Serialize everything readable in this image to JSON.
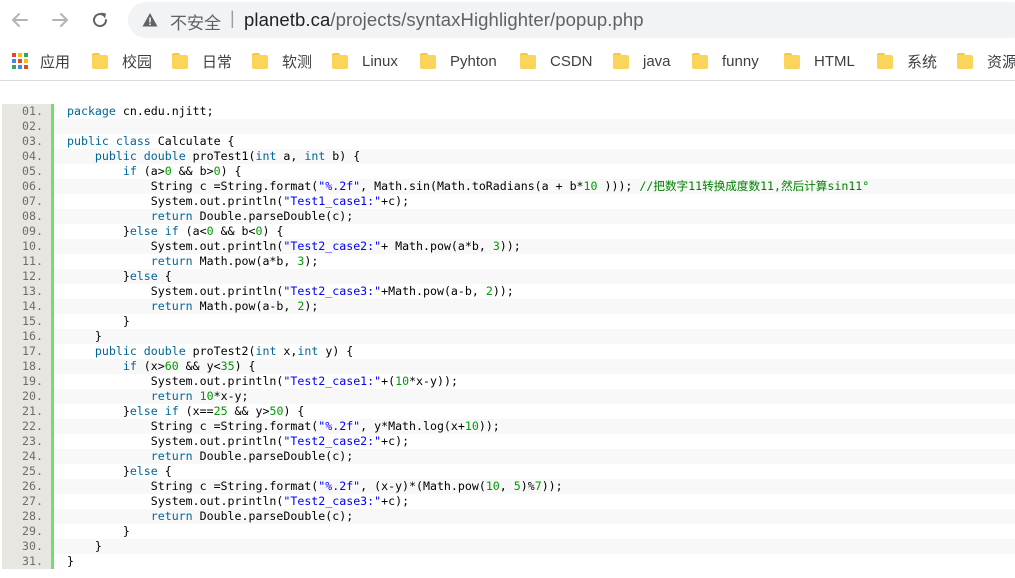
{
  "browser": {
    "security_label": "不安全",
    "separator": "|",
    "url_domain": "planetb.ca",
    "url_path": "/projects/syntaxHighlighter/popup.php"
  },
  "bookmarks": {
    "apps_label": "应用",
    "items": [
      "校园",
      "日常",
      "软测",
      "Linux",
      "Pyhton",
      "CSDN",
      "java",
      "funny",
      "HTML",
      "系统",
      "资源"
    ]
  },
  "code": {
    "lines": [
      {
        "n": "01.",
        "t": [
          [
            "kw",
            "package"
          ],
          [
            "plain",
            " cn.edu.njitt;"
          ]
        ]
      },
      {
        "n": "02.",
        "t": []
      },
      {
        "n": "03.",
        "t": [
          [
            "kw",
            "public"
          ],
          [
            "plain",
            " "
          ],
          [
            "kw",
            "class"
          ],
          [
            "plain",
            " Calculate {"
          ]
        ]
      },
      {
        "n": "04.",
        "t": [
          [
            "plain",
            "    "
          ],
          [
            "kw",
            "public"
          ],
          [
            "plain",
            " "
          ],
          [
            "kw",
            "double"
          ],
          [
            "plain",
            " proTest1("
          ],
          [
            "kw",
            "int"
          ],
          [
            "plain",
            " a, "
          ],
          [
            "kw",
            "int"
          ],
          [
            "plain",
            " b) {"
          ]
        ]
      },
      {
        "n": "05.",
        "t": [
          [
            "plain",
            "        "
          ],
          [
            "kw",
            "if"
          ],
          [
            "plain",
            " (a>"
          ],
          [
            "num",
            "0"
          ],
          [
            "plain",
            " && b>"
          ],
          [
            "num",
            "0"
          ],
          [
            "plain",
            ") {"
          ]
        ]
      },
      {
        "n": "06.",
        "t": [
          [
            "plain",
            "            String c =String.format("
          ],
          [
            "str",
            "\"%.2f\""
          ],
          [
            "plain",
            ", Math.sin(Math.toRadians(a + b*"
          ],
          [
            "num",
            "10"
          ],
          [
            "plain",
            " ))); "
          ],
          [
            "cmt",
            "//把数字11转换成度数11,然后计算sin11°"
          ]
        ]
      },
      {
        "n": "07.",
        "t": [
          [
            "plain",
            "            System.out.println("
          ],
          [
            "str",
            "\"Test1_case1:\""
          ],
          [
            "plain",
            "+c);"
          ]
        ]
      },
      {
        "n": "08.",
        "t": [
          [
            "plain",
            "            "
          ],
          [
            "kw",
            "return"
          ],
          [
            "plain",
            " Double.parseDouble(c);"
          ]
        ]
      },
      {
        "n": "09.",
        "t": [
          [
            "plain",
            "        }"
          ],
          [
            "kw",
            "else"
          ],
          [
            "plain",
            " "
          ],
          [
            "kw",
            "if"
          ],
          [
            "plain",
            " (a<"
          ],
          [
            "num",
            "0"
          ],
          [
            "plain",
            " && b<"
          ],
          [
            "num",
            "0"
          ],
          [
            "plain",
            ") {"
          ]
        ]
      },
      {
        "n": "10.",
        "t": [
          [
            "plain",
            "            System.out.println("
          ],
          [
            "str",
            "\"Test2_case2:\""
          ],
          [
            "plain",
            "+ Math.pow(a*b, "
          ],
          [
            "num",
            "3"
          ],
          [
            "plain",
            "));"
          ]
        ]
      },
      {
        "n": "11.",
        "t": [
          [
            "plain",
            "            "
          ],
          [
            "kw",
            "return"
          ],
          [
            "plain",
            " Math.pow(a*b, "
          ],
          [
            "num",
            "3"
          ],
          [
            "plain",
            ");"
          ]
        ]
      },
      {
        "n": "12.",
        "t": [
          [
            "plain",
            "        }"
          ],
          [
            "kw",
            "else"
          ],
          [
            "plain",
            " {"
          ]
        ]
      },
      {
        "n": "13.",
        "t": [
          [
            "plain",
            "            System.out.println("
          ],
          [
            "str",
            "\"Test2_case3:\""
          ],
          [
            "plain",
            "+Math.pow(a-b, "
          ],
          [
            "num",
            "2"
          ],
          [
            "plain",
            "));"
          ]
        ]
      },
      {
        "n": "14.",
        "t": [
          [
            "plain",
            "            "
          ],
          [
            "kw",
            "return"
          ],
          [
            "plain",
            " Math.pow(a-b, "
          ],
          [
            "num",
            "2"
          ],
          [
            "plain",
            ");"
          ]
        ]
      },
      {
        "n": "15.",
        "t": [
          [
            "plain",
            "        }"
          ]
        ]
      },
      {
        "n": "16.",
        "t": [
          [
            "plain",
            "    }"
          ]
        ]
      },
      {
        "n": "17.",
        "t": [
          [
            "plain",
            "    "
          ],
          [
            "kw",
            "public"
          ],
          [
            "plain",
            " "
          ],
          [
            "kw",
            "double"
          ],
          [
            "plain",
            " proTest2("
          ],
          [
            "kw",
            "int"
          ],
          [
            "plain",
            " x,"
          ],
          [
            "kw",
            "int"
          ],
          [
            "plain",
            " y) {"
          ]
        ]
      },
      {
        "n": "18.",
        "t": [
          [
            "plain",
            "        "
          ],
          [
            "kw",
            "if"
          ],
          [
            "plain",
            " (x>"
          ],
          [
            "num",
            "60"
          ],
          [
            "plain",
            " && y<"
          ],
          [
            "num",
            "35"
          ],
          [
            "plain",
            ") {"
          ]
        ]
      },
      {
        "n": "19.",
        "t": [
          [
            "plain",
            "            System.out.println("
          ],
          [
            "str",
            "\"Test2_case1:\""
          ],
          [
            "plain",
            "+("
          ],
          [
            "num",
            "10"
          ],
          [
            "plain",
            "*x-y));"
          ]
        ]
      },
      {
        "n": "20.",
        "t": [
          [
            "plain",
            "            "
          ],
          [
            "kw",
            "return"
          ],
          [
            "plain",
            " "
          ],
          [
            "num",
            "10"
          ],
          [
            "plain",
            "*x-y;"
          ]
        ]
      },
      {
        "n": "21.",
        "t": [
          [
            "plain",
            "        }"
          ],
          [
            "kw",
            "else"
          ],
          [
            "plain",
            " "
          ],
          [
            "kw",
            "if"
          ],
          [
            "plain",
            " (x=="
          ],
          [
            "num",
            "25"
          ],
          [
            "plain",
            " && y>"
          ],
          [
            "num",
            "50"
          ],
          [
            "plain",
            ") {"
          ]
        ]
      },
      {
        "n": "22.",
        "t": [
          [
            "plain",
            "            String c =String.format("
          ],
          [
            "str",
            "\"%.2f\""
          ],
          [
            "plain",
            ", y*Math.log(x+"
          ],
          [
            "num",
            "10"
          ],
          [
            "plain",
            "));"
          ]
        ]
      },
      {
        "n": "23.",
        "t": [
          [
            "plain",
            "            System.out.println("
          ],
          [
            "str",
            "\"Test2_case2:\""
          ],
          [
            "plain",
            "+c);"
          ]
        ]
      },
      {
        "n": "24.",
        "t": [
          [
            "plain",
            "            "
          ],
          [
            "kw",
            "return"
          ],
          [
            "plain",
            " Double.parseDouble(c);"
          ]
        ]
      },
      {
        "n": "25.",
        "t": [
          [
            "plain",
            "        }"
          ],
          [
            "kw",
            "else"
          ],
          [
            "plain",
            " {"
          ]
        ]
      },
      {
        "n": "26.",
        "t": [
          [
            "plain",
            "            String c =String.format("
          ],
          [
            "str",
            "\"%.2f\""
          ],
          [
            "plain",
            ", (x-y)*(Math.pow("
          ],
          [
            "num",
            "10"
          ],
          [
            "plain",
            ", "
          ],
          [
            "num",
            "5"
          ],
          [
            "plain",
            ")%"
          ],
          [
            "num",
            "7"
          ],
          [
            "plain",
            "));"
          ]
        ]
      },
      {
        "n": "27.",
        "t": [
          [
            "plain",
            "            System.out.println("
          ],
          [
            "str",
            "\"Test2_case3:\""
          ],
          [
            "plain",
            "+c);"
          ]
        ]
      },
      {
        "n": "28.",
        "t": [
          [
            "plain",
            "            "
          ],
          [
            "kw",
            "return"
          ],
          [
            "plain",
            " Double.parseDouble(c);"
          ]
        ]
      },
      {
        "n": "29.",
        "t": [
          [
            "plain",
            "        }"
          ]
        ]
      },
      {
        "n": "30.",
        "t": [
          [
            "plain",
            "    }"
          ]
        ]
      },
      {
        "n": "31.",
        "t": [
          [
            "plain",
            "}"
          ]
        ]
      }
    ]
  },
  "colors": {
    "keyword": "#006699",
    "string": "#0000ff",
    "number": "#009900",
    "comment": "#008200",
    "gutter_bar": "#6ce26c",
    "folder": "#fbd45c",
    "apps_grid": [
      "#ea4335",
      "#fbbc04",
      "#34a853",
      "#4285f4",
      "#ea4335",
      "#fbbc04",
      "#34a853",
      "#4285f4",
      "#ea4335"
    ]
  }
}
